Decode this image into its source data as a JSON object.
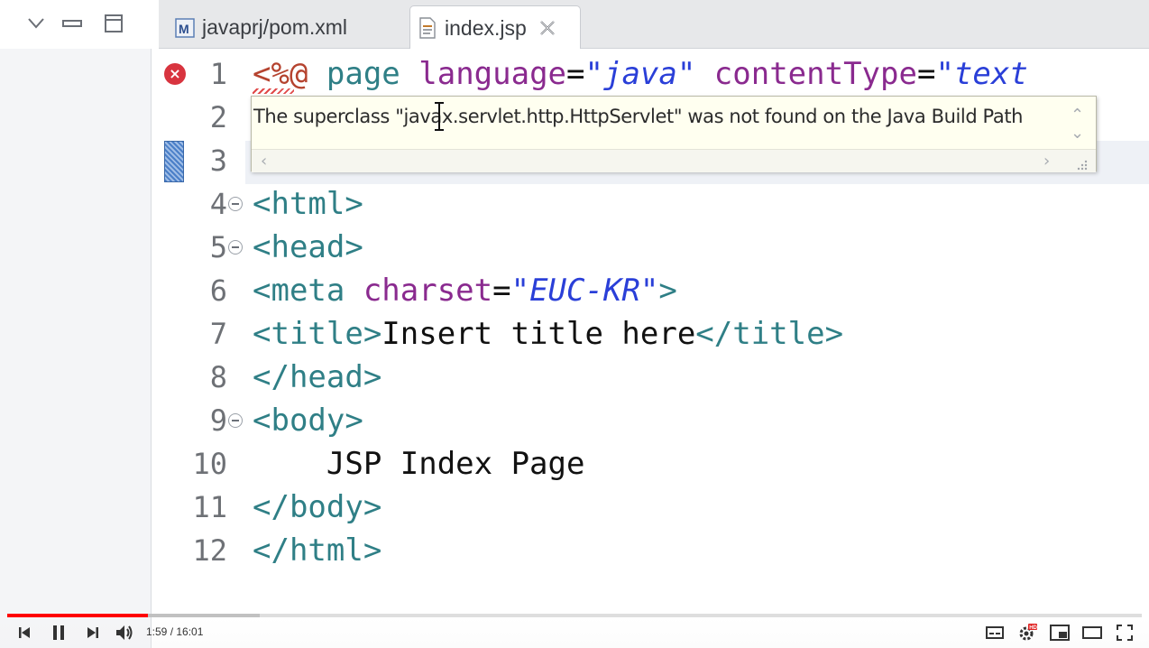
{
  "tabs": [
    {
      "label": "javaprj/pom.xml",
      "icon": "maven-pom-icon",
      "active": false
    },
    {
      "label": "index.jsp",
      "icon": "jsp-file-icon",
      "active": true
    }
  ],
  "editor": {
    "line_numbers": [
      "1",
      "2",
      "3",
      "4",
      "5",
      "6",
      "7",
      "8",
      "9",
      "10",
      "11",
      "12"
    ],
    "lines": {
      "l1": {
        "a": "<%@ ",
        "b": "page ",
        "c": "language",
        "d": "=",
        "e": "\"java\"",
        "f": " contentType",
        "g": "=",
        "h": "\"text"
      },
      "l4": {
        "a": "<html>"
      },
      "l5": {
        "a": "<head>"
      },
      "l6": {
        "a": "<meta ",
        "b": "charset",
        "c": "=",
        "d": "\"EUC-KR\"",
        "e": ">"
      },
      "l7": {
        "a": "<title>",
        "b": "Insert title here",
        "c": "</title>"
      },
      "l8": {
        "a": "</head>"
      },
      "l9": {
        "a": "<body>"
      },
      "l10": {
        "a": "    JSP Index Page"
      },
      "l11": {
        "a": "</body>"
      },
      "l12": {
        "a": "</html>"
      }
    },
    "error_marker": "error-icon"
  },
  "hover": {
    "message": "The superclass \"javax.servlet.http.HttpServlet\" was not found on the Java Build Path"
  },
  "video": {
    "time": "1:59 / 16:01",
    "progress": 0.124,
    "accent_color": "#ff0000"
  }
}
